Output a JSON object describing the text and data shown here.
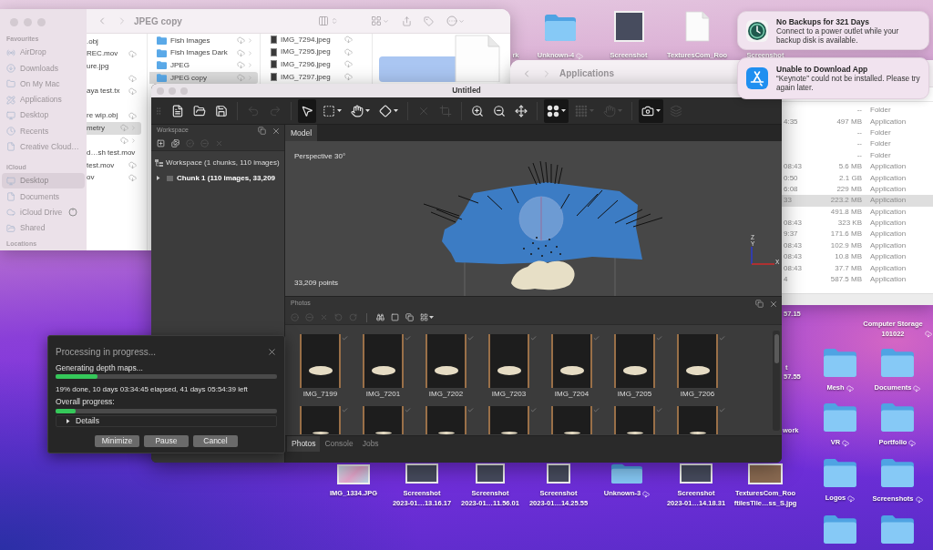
{
  "desktop": {
    "top_icons": [
      {
        "kind": "fragment",
        "label_lines": [
          "rk"
        ],
        "cloud": false
      },
      {
        "kind": "folder",
        "label_lines": [
          "Unknown-4"
        ],
        "cloud": true
      },
      {
        "kind": "screenshot",
        "label_lines": [
          "Screenshot"
        ],
        "cloud": false
      },
      {
        "kind": "document",
        "label_lines": [
          "TexturesCom_Roo"
        ],
        "cloud": false
      },
      {
        "kind": "fragment",
        "label_lines": [
          "Screenshot"
        ],
        "cloud": false
      }
    ],
    "bottom_icons": [
      {
        "kind": "photo",
        "label_lines": [
          "IMG_1334.JPG"
        ],
        "cloud": false
      },
      {
        "kind": "screenshot",
        "label_lines": [
          "Screenshot",
          "2023-01…13.16.17"
        ],
        "cloud": false
      },
      {
        "kind": "screenshot",
        "label_lines": [
          "Screenshot",
          "2023-01…11.56.01"
        ],
        "cloud": false
      },
      {
        "kind": "screenshot",
        "label_lines": [
          "Screenshot",
          "2023-01…14.25.55"
        ],
        "cloud": false
      },
      {
        "kind": "folder",
        "label_lines": [
          "Unknown-3"
        ],
        "cloud": true
      },
      {
        "kind": "screenshot",
        "label_lines": [
          "Screenshot",
          "2023-01…14.18.31"
        ],
        "cloud": false
      },
      {
        "kind": "texture",
        "label_lines": [
          "TexturesCom_Roo",
          "ftilesTile…ss_S.jpg"
        ],
        "cloud": false
      }
    ],
    "right_icons": [
      {
        "kind": "fragment",
        "label_lines": [
          "Computer Storage",
          "101022"
        ],
        "cloud": true
      },
      {
        "kind": "folder",
        "label_lines": [
          "Mesh"
        ],
        "cloud": true
      },
      {
        "kind": "folder",
        "label_lines": [
          "Documents"
        ],
        "cloud": true
      },
      {
        "kind": "folder",
        "label_lines": [
          "VR"
        ],
        "cloud": true
      },
      {
        "kind": "folder",
        "label_lines": [
          "Portfolio"
        ],
        "cloud": true
      },
      {
        "kind": "folder",
        "label_lines": [
          "Logos"
        ],
        "cloud": true
      },
      {
        "kind": "folder",
        "label_lines": [
          "Screenshots"
        ],
        "cloud": true
      },
      {
        "kind": "folder"
      },
      {
        "kind": "folder"
      }
    ],
    "cut_labels": [
      "57.15",
      "t",
      "57.55",
      "work"
    ]
  },
  "finder_window": {
    "title": "JPEG copy",
    "sidebar": [
      {
        "heading": "Favourites",
        "items": [
          {
            "label": "AirDrop",
            "kind": "airdrop",
            "selected": false,
            "syncing": false
          },
          {
            "label": "Downloads",
            "kind": "downloads",
            "selected": false,
            "syncing": false
          },
          {
            "label": "On My Mac",
            "kind": "folder",
            "selected": false,
            "syncing": false
          },
          {
            "label": "Applications",
            "kind": "applications",
            "selected": false,
            "syncing": false
          },
          {
            "label": "Desktop",
            "kind": "desktop",
            "selected": false,
            "syncing": false
          },
          {
            "label": "Recents",
            "kind": "recents",
            "selected": false,
            "syncing": false
          },
          {
            "label": "Creative Cloud…",
            "kind": "document",
            "selected": false,
            "syncing": false
          }
        ]
      },
      {
        "heading": "iCloud",
        "items": [
          {
            "label": "Desktop",
            "kind": "desktop",
            "selected": true,
            "syncing": false
          },
          {
            "label": "Documents",
            "kind": "document",
            "selected": false,
            "syncing": false
          },
          {
            "label": "iCloud Drive",
            "kind": "cloud",
            "selected": false,
            "syncing": true
          },
          {
            "label": "Shared",
            "kind": "shared",
            "selected": false,
            "syncing": false
          }
        ]
      },
      {
        "heading": "Locations"
      }
    ],
    "columns": [
      {
        "rows": [
          {
            "kind": "clipped",
            "name": ".obj",
            "cloud": false,
            "expandable": false,
            "selected": false
          },
          {
            "kind": "clipped",
            "name": "REC.mov",
            "cloud": true,
            "expandable": false,
            "selected": false
          },
          {
            "kind": "clipped",
            "name": "ure.jpg",
            "cloud": false,
            "expandable": false,
            "selected": false
          },
          {
            "kind": "clipped",
            "cloud": true,
            "expandable": false,
            "selected": false
          },
          {
            "kind": "clipped",
            "name": "aya test.tx",
            "cloud": true,
            "expandable": false,
            "selected": false
          },
          {
            "kind": "clipped",
            "cloud": false,
            "expandable": false,
            "selected": false
          },
          {
            "kind": "clipped",
            "name": "re wip.obj",
            "cloud": true,
            "expandable": false,
            "selected": false
          },
          {
            "kind": "clipped",
            "name": "metry",
            "cloud": true,
            "expandable": true,
            "selected": true
          },
          {
            "kind": "clipped",
            "cloud": true,
            "expandable": true,
            "selected": false
          },
          {
            "kind": "clipped",
            "name": "d…sh test.mov",
            "cloud": false,
            "expandable": false,
            "selected": false
          },
          {
            "kind": "clipped",
            "name": "test.mov",
            "cloud": true,
            "expandable": false,
            "selected": false
          },
          {
            "kind": "clipped",
            "name": "ov",
            "cloud": true,
            "expandable": false,
            "selected": false
          }
        ]
      },
      {
        "rows": [
          {
            "kind": "folder",
            "name": "Fish Images",
            "cloud": true,
            "expandable": true,
            "selected": false
          },
          {
            "kind": "folder",
            "name": "Fish Images Dark",
            "cloud": true,
            "expandable": true,
            "selected": false
          },
          {
            "kind": "folder",
            "name": "JPEG",
            "cloud": true,
            "expandable": true,
            "selected": false
          },
          {
            "kind": "folder",
            "name": "JPEG copy",
            "cloud": true,
            "expandable": true,
            "selected": true
          }
        ]
      },
      {
        "rows": [
          {
            "kind": "image",
            "name": "IMG_7294.jpeg",
            "cloud": true,
            "expandable": false,
            "selected": false
          },
          {
            "kind": "image",
            "name": "IMG_7295.jpeg",
            "cloud": true,
            "expandable": false,
            "selected": false
          },
          {
            "kind": "image",
            "name": "IMG_7296.jpeg",
            "cloud": true,
            "expandable": false,
            "selected": false
          },
          {
            "kind": "image",
            "name": "IMG_7297.jpeg",
            "cloud": true,
            "expandable": false,
            "selected": false
          }
        ]
      }
    ]
  },
  "applications_window": {
    "title": "Applications",
    "rows": [
      {
        "size": "--",
        "file_kind": "Folder",
        "selected": false
      },
      {
        "date": "4:35",
        "size": "497 MB",
        "file_kind": "Application",
        "selected": false
      },
      {
        "size": "--",
        "file_kind": "Folder",
        "selected": false
      },
      {
        "size": "--",
        "file_kind": "Folder",
        "selected": false
      },
      {
        "size": "--",
        "file_kind": "Folder",
        "selected": false
      },
      {
        "date": "08:43",
        "size": "5.6 MB",
        "file_kind": "Application",
        "selected": false
      },
      {
        "date": "0:50",
        "size": "2.1 GB",
        "file_kind": "Application",
        "selected": false
      },
      {
        "date": "6:08",
        "size": "229 MB",
        "file_kind": "Application",
        "selected": false
      },
      {
        "date": "33",
        "size": "223.2 MB",
        "file_kind": "Application",
        "selected": true
      },
      {
        "size": "491.8 MB",
        "file_kind": "Application",
        "selected": false
      },
      {
        "date": "08:43",
        "size": "323 KB",
        "file_kind": "Application",
        "selected": false
      },
      {
        "date": "9:37",
        "size": "171.6 MB",
        "file_kind": "Application",
        "selected": false
      },
      {
        "date": "08:43",
        "size": "102.9 MB",
        "file_kind": "Application",
        "selected": false
      },
      {
        "date": "08:43",
        "size": "10.8 MB",
        "file_kind": "Application",
        "selected": false
      },
      {
        "date": "08:43",
        "size": "37.7 MB",
        "file_kind": "Application",
        "selected": false
      },
      {
        "date": "4",
        "size": "587.5 MB",
        "file_kind": "Application",
        "selected": false
      }
    ]
  },
  "notifications": [
    {
      "kind": "backup",
      "title": "No Backups for 321 Days",
      "body": "Connect to a power outlet while your backup disk is available."
    },
    {
      "kind": "store",
      "title": "Unable to Download App",
      "body": "“Keynote” could not be installed. Please try again later."
    }
  ],
  "metashape_window": {
    "title": "Untitled",
    "toolbar": [
      {
        "kind": "new",
        "selected": false,
        "disabled": false,
        "dropdown": false
      },
      {
        "kind": "open",
        "selected": false,
        "disabled": false,
        "dropdown": false
      },
      {
        "kind": "save",
        "selected": false,
        "disabled": false,
        "dropdown": false
      },
      {
        "kind": "separator"
      },
      {
        "kind": "undo",
        "selected": false,
        "disabled": true,
        "dropdown": false
      },
      {
        "kind": "redo",
        "selected": false,
        "disabled": true,
        "dropdown": false
      },
      {
        "kind": "separator"
      },
      {
        "kind": "select",
        "selected": true,
        "disabled": false,
        "dropdown": false
      },
      {
        "kind": "marquee",
        "selected": false,
        "disabled": false,
        "dropdown": true
      },
      {
        "kind": "shape",
        "selected": false,
        "disabled": false,
        "dropdown": true
      },
      {
        "kind": "polygon",
        "selected": false,
        "disabled": false,
        "dropdown": true
      },
      {
        "kind": "separator"
      },
      {
        "kind": "delete",
        "selected": false,
        "disabled": true,
        "dropdown": false
      },
      {
        "kind": "crop",
        "selected": false,
        "disabled": true,
        "dropdown": false
      },
      {
        "kind": "separator"
      },
      {
        "kind": "zoomin",
        "selected": false,
        "disabled": false,
        "dropdown": false
      },
      {
        "kind": "zoomout",
        "selected": false,
        "disabled": false,
        "dropdown": false
      },
      {
        "kind": "move",
        "selected": false,
        "disabled": false,
        "dropdown": false
      },
      {
        "kind": "separator"
      },
      {
        "kind": "points",
        "selected": true,
        "disabled": false,
        "dropdown": true
      },
      {
        "kind": "dense",
        "selected": false,
        "disabled": true,
        "dropdown": true
      },
      {
        "kind": "mesh",
        "selected": false,
        "disabled": true,
        "dropdown": true
      },
      {
        "kind": "separator"
      },
      {
        "kind": "camera",
        "selected": true,
        "disabled": false,
        "dropdown": true
      },
      {
        "kind": "layers",
        "selected": false,
        "disabled": true,
        "dropdown": false
      }
    ],
    "workspace_panel": {
      "title": "Workspace",
      "toolbar": [
        {
          "kind": "addchunk",
          "disabled": false
        },
        {
          "kind": "addphotos",
          "disabled": false
        },
        {
          "kind": "enable",
          "disabled": true
        },
        {
          "kind": "disable",
          "disabled": true
        },
        {
          "kind": "remove",
          "disabled": true
        }
      ],
      "tree": [
        {
          "label": "Workspace (1 chunks, 110 images)",
          "children": [
            {
              "label": "Chunk 1 (110 images, 33,209",
              "expanded": false,
              "active": true
            }
          ]
        }
      ]
    },
    "model_tabs": [
      {
        "label": "Model",
        "selected": true
      }
    ],
    "model_view": {
      "projection": "Perspective 30°",
      "point_count": "33,209 points",
      "axis_labels": [
        "Z",
        "Y",
        "X"
      ]
    },
    "photos_panel": {
      "title": "Photos",
      "toolbar": [
        {
          "kind": "enable",
          "disabled": true,
          "dropdown": false
        },
        {
          "kind": "disable",
          "disabled": true,
          "dropdown": false
        },
        {
          "kind": "remove",
          "disabled": true,
          "dropdown": false
        },
        {
          "kind": "rotateleft",
          "disabled": true,
          "dropdown": false
        },
        {
          "kind": "rotateright",
          "disabled": true,
          "dropdown": false
        },
        {
          "kind": "separator"
        },
        {
          "kind": "find",
          "disabled": false,
          "dropdown": false
        },
        {
          "kind": "single",
          "disabled": false,
          "dropdown": false
        },
        {
          "kind": "stack",
          "disabled": false,
          "dropdown": false
        },
        {
          "kind": "grid",
          "disabled": false,
          "dropdown": true
        }
      ],
      "rows": [
        {
          "photos": [
            {
              "label": "IMG_7199",
              "checked": true
            },
            {
              "label": "IMG_7201",
              "checked": true
            },
            {
              "label": "IMG_7202",
              "checked": true
            },
            {
              "label": "IMG_7203",
              "checked": true
            },
            {
              "label": "IMG_7204",
              "checked": true
            },
            {
              "label": "IMG_7205",
              "checked": true
            },
            {
              "label": "IMG_7206",
              "checked": true
            }
          ]
        },
        {
          "photos": [
            {
              "checked": true
            },
            {
              "checked": true
            },
            {
              "checked": true
            },
            {
              "checked": true
            },
            {
              "checked": true
            },
            {
              "checked": true
            },
            {
              "checked": true
            }
          ]
        }
      ]
    },
    "bottom_tabs": [
      {
        "label": "Photos",
        "selected": true
      },
      {
        "label": "Console",
        "selected": false
      },
      {
        "label": "Jobs",
        "selected": false
      }
    ]
  },
  "processing_dialog": {
    "title": "Processing in progress...",
    "task": {
      "label": "Generating depth maps...",
      "level": 0.19
    },
    "status": "19% done, 10 days 03:34:45 elapsed, 41 days 05:54:39 left",
    "overall": {
      "label": "Overall progress:",
      "level": 0.09
    },
    "details": {
      "label": "Details",
      "expanded": false
    },
    "buttons": [
      "Minimize",
      "Pause",
      "Cancel"
    ]
  }
}
